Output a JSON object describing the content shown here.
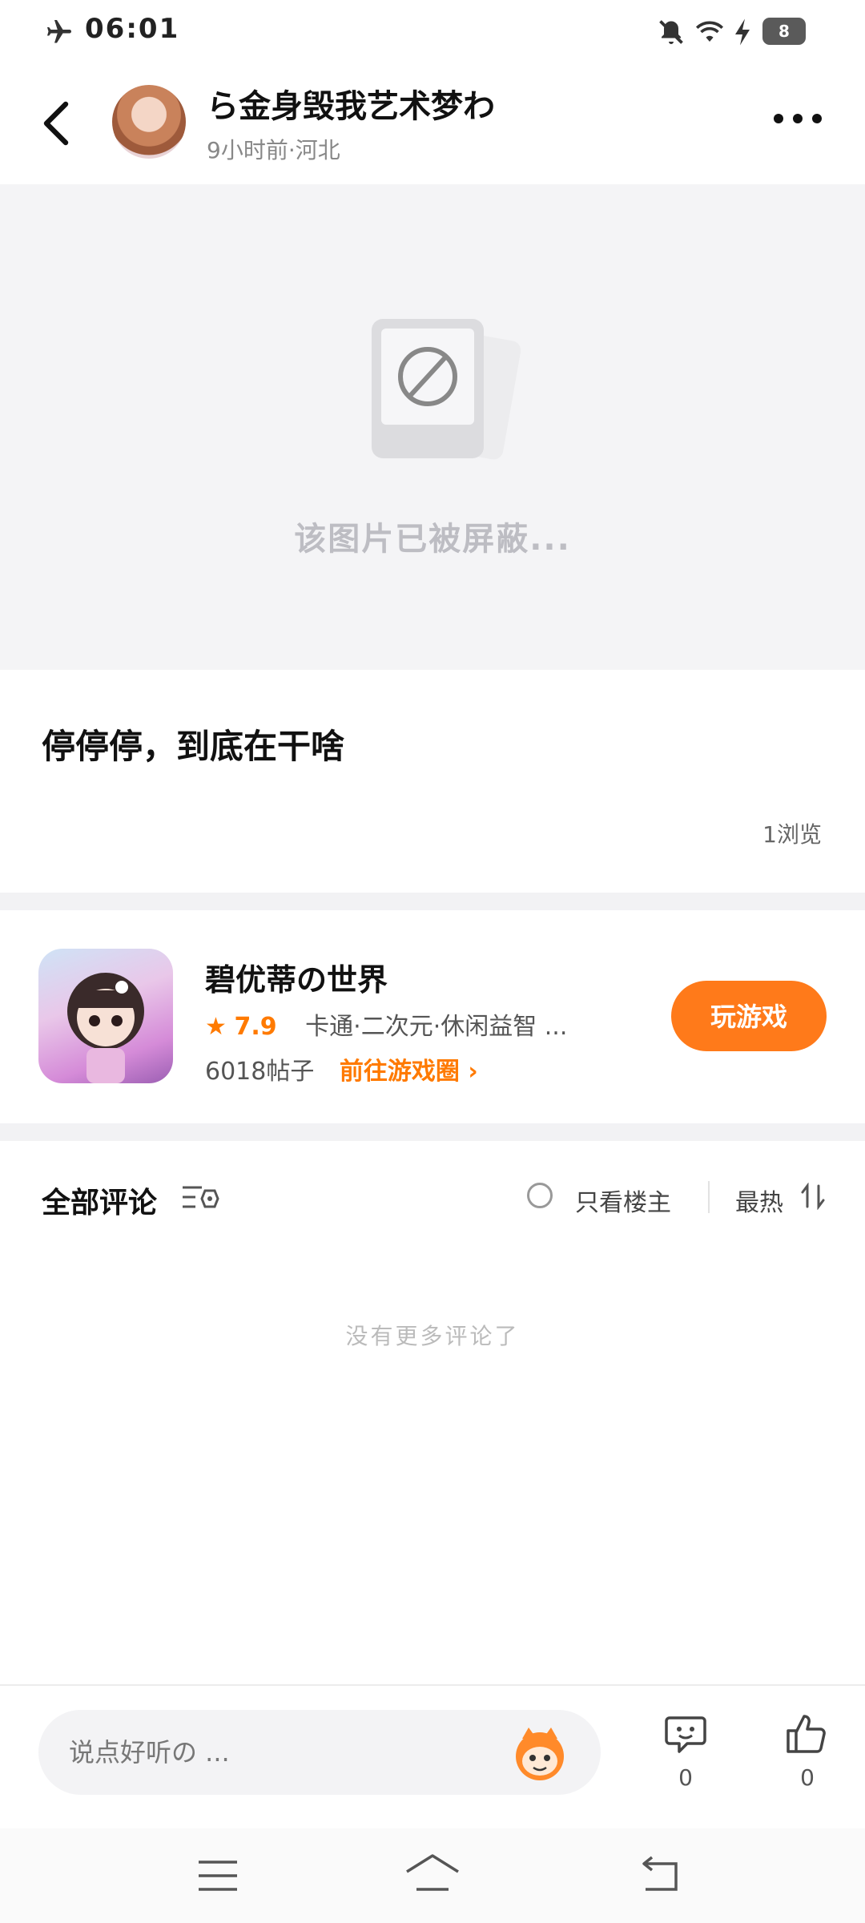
{
  "status_bar": {
    "time": "06:01",
    "battery": "8"
  },
  "header": {
    "nickname": "ら金身毁我艺术梦わ",
    "meta": "9小时前·河北"
  },
  "image": {
    "blocked_text": "该图片已被屏蔽..."
  },
  "post": {
    "title": "停停停，到底在干啥",
    "views": "1浏览"
  },
  "game": {
    "name": "碧优蒂の世界",
    "rating": "7.9",
    "tags": "卡通·二次元·休闲益智 ...",
    "posts": "6018帖子",
    "circle_link": "前往游戏圈",
    "play_label": "玩游戏"
  },
  "comments": {
    "title": "全部评论",
    "only_op": "只看楼主",
    "sort": "最热",
    "empty": "没有更多评论了"
  },
  "bottom": {
    "placeholder": "说点好听の ...",
    "comment_count": "0",
    "like_count": "0"
  },
  "colors": {
    "accent": "#ff7a1a",
    "background": "#ffffff",
    "placeholder_bg": "#f4f4f6"
  }
}
